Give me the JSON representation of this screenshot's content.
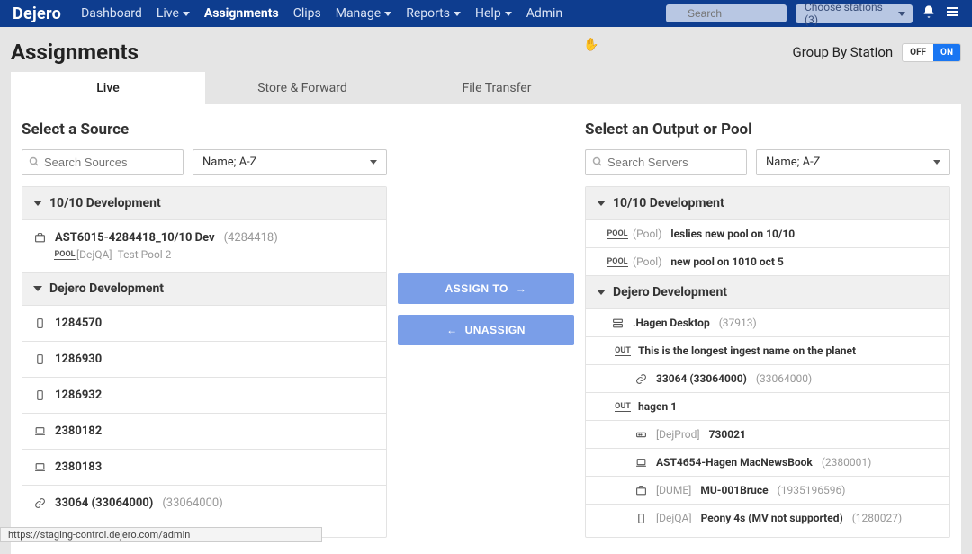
{
  "brand": "Dejero",
  "nav": {
    "items": [
      "Dashboard",
      "Live",
      "Assignments",
      "Clips",
      "Manage",
      "Reports",
      "Help",
      "Admin"
    ],
    "dropdown_flags": [
      false,
      true,
      false,
      false,
      true,
      true,
      true,
      false
    ],
    "active_index": 2,
    "search_placeholder": "Search",
    "stations_label": "Choose stations (3)"
  },
  "page": {
    "title": "Assignments",
    "group_by_label": "Group By Station",
    "toggle_off": "OFF",
    "toggle_on": "ON"
  },
  "tabs": {
    "items": [
      "Live",
      "Store & Forward",
      "File Transfer"
    ],
    "active_index": 0
  },
  "sources": {
    "title": "Select a Source",
    "search_placeholder": "Search Sources",
    "sort_label": "Name; A-Z",
    "groups": [
      {
        "name": "10/10 Development",
        "items": [
          {
            "icon": "briefcase",
            "label": "AST6015-4284418_10/10 Dev",
            "meta": "(4284418)",
            "sub_badge": "[DejQA]",
            "sub_text": "Test Pool 2",
            "sub_icon": "pool"
          }
        ]
      },
      {
        "name": "Dejero Development",
        "items": [
          {
            "icon": "device",
            "label": "1284570"
          },
          {
            "icon": "device",
            "label": "1286930"
          },
          {
            "icon": "device",
            "label": "1286932"
          },
          {
            "icon": "laptop",
            "label": "2380182"
          },
          {
            "icon": "laptop",
            "label": "2380183"
          },
          {
            "icon": "link",
            "label": "33064 (33064000)",
            "meta": "(33064000)"
          }
        ]
      }
    ]
  },
  "actions": {
    "assign": "ASSIGN TO",
    "unassign": "UNASSIGN"
  },
  "outputs": {
    "title": "Select an Output or Pool",
    "search_placeholder": "Search Servers",
    "sort_label": "Name; A-Z",
    "groups": [
      {
        "name": "10/10 Development",
        "items": [
          {
            "icon": "pool",
            "prefix": "(Pool)",
            "label": "leslies new pool on 10/10"
          },
          {
            "icon": "pool",
            "prefix": "(Pool)",
            "label": "new pool on 1010 oct 5"
          }
        ]
      },
      {
        "name": "Dejero Development",
        "items": [
          {
            "icon": "server",
            "label": ".Hagen Desktop",
            "meta": "(37913)",
            "indent": 0
          },
          {
            "icon": "out",
            "label": "This is the longest ingest name on the planet",
            "indent": 1
          },
          {
            "icon": "link",
            "label": "33064 (33064000)",
            "meta": "(33064000)",
            "indent": 2
          },
          {
            "icon": "out",
            "label": "hagen 1",
            "indent": 1
          },
          {
            "icon": "gateway",
            "badge": "[DejProd]",
            "label": "730021",
            "indent": 2
          },
          {
            "icon": "laptop",
            "label": "AST4654-Hagen MacNewsBook",
            "meta": "(2380001)",
            "indent": 2
          },
          {
            "icon": "briefcase",
            "badge": "[DUME]",
            "label": "MU-001Bruce",
            "meta": "(1935196596)",
            "indent": 2
          },
          {
            "icon": "device",
            "badge": "[DejQA]",
            "label": "Peony 4s (MV not supported)",
            "meta": "(1280027)",
            "indent": 2
          }
        ]
      }
    ]
  },
  "status_url": "https://staging-control.dejero.com/admin"
}
